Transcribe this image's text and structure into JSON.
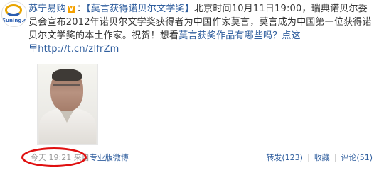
{
  "avatar": {
    "brand": "Suning.com"
  },
  "post": {
    "author": "苏宁易购",
    "verified_mark": "V",
    "colon": "：",
    "title_link": "【莫言获得诺贝尔文学奖】",
    "line1_text": "北京时间10月11日19:00，瑞典诺贝尔委",
    "line2_text": "员会宣布2012年诺贝尔文学奖获得者为中国作家莫言，莫言成为中国第一位获得诺",
    "line3_text": "贝尔文学奖的本土作家。祝贺！想看",
    "line3_link": "莫言获奖作品有哪些吗？点这",
    "line4_link": "里",
    "short_url": "http://t.cn/zlfrZm"
  },
  "meta": {
    "time": "今天 19:21",
    "source_prefix": "来自",
    "source": "专业版微博",
    "repost": "转发(123)",
    "favorite": "收藏",
    "comment": "评论(51)",
    "separator": "|"
  },
  "colors": {
    "link": "#2f5e9e",
    "highlight_circle": "#e01010",
    "meta_text": "#9a9a9a"
  }
}
